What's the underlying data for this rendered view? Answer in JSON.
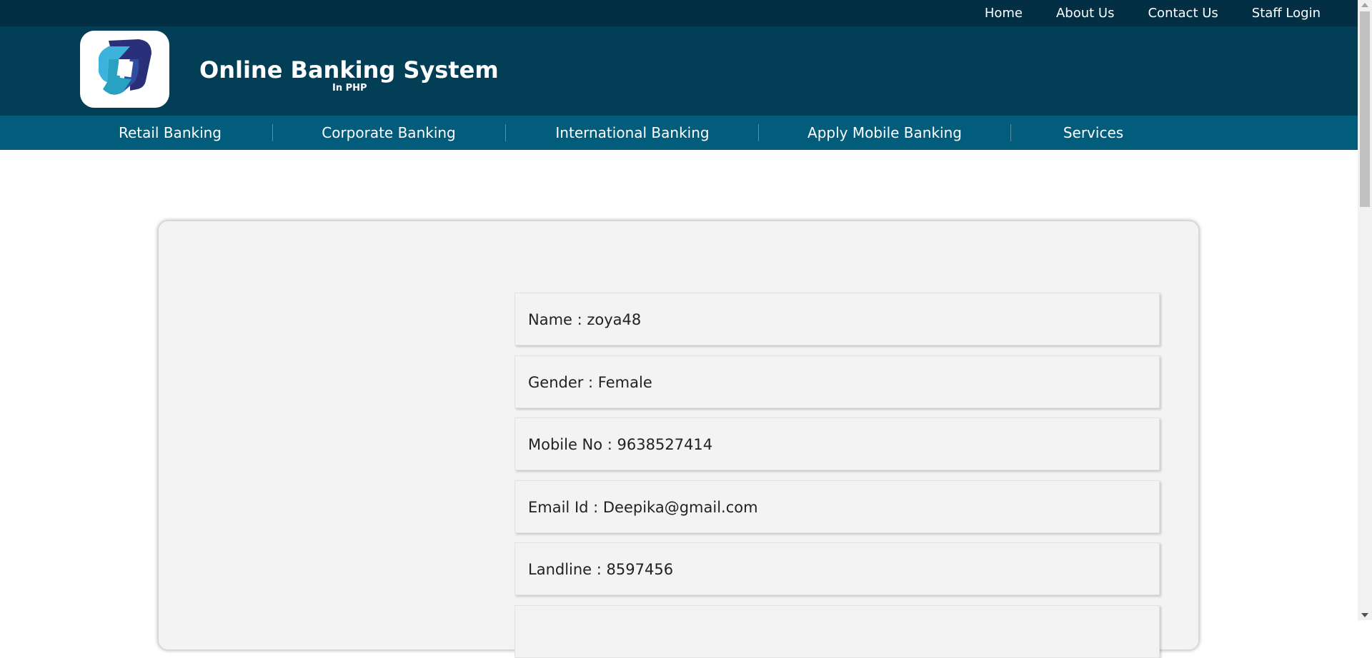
{
  "top_nav": {
    "items": [
      "Home",
      "About Us",
      "Contact Us",
      "Staff Login"
    ]
  },
  "brand": {
    "title": "Online Banking System",
    "subtitle": "In PHP",
    "logo_icon": "bank-logo-icon"
  },
  "main_nav": {
    "items": [
      "Retail Banking",
      "Corporate Banking",
      "International Banking",
      "Apply Mobile Banking",
      "Services"
    ]
  },
  "profile": {
    "fields": [
      "Name : zoya48",
      "Gender : Female",
      "Mobile No : 9638527414",
      "Email Id : Deepika@gmail.com",
      "Landline : 8597456",
      ""
    ]
  },
  "colors": {
    "topbar": "#022f44",
    "header": "#023f56",
    "nav": "#025c7c",
    "card": "#f3f3f3"
  }
}
